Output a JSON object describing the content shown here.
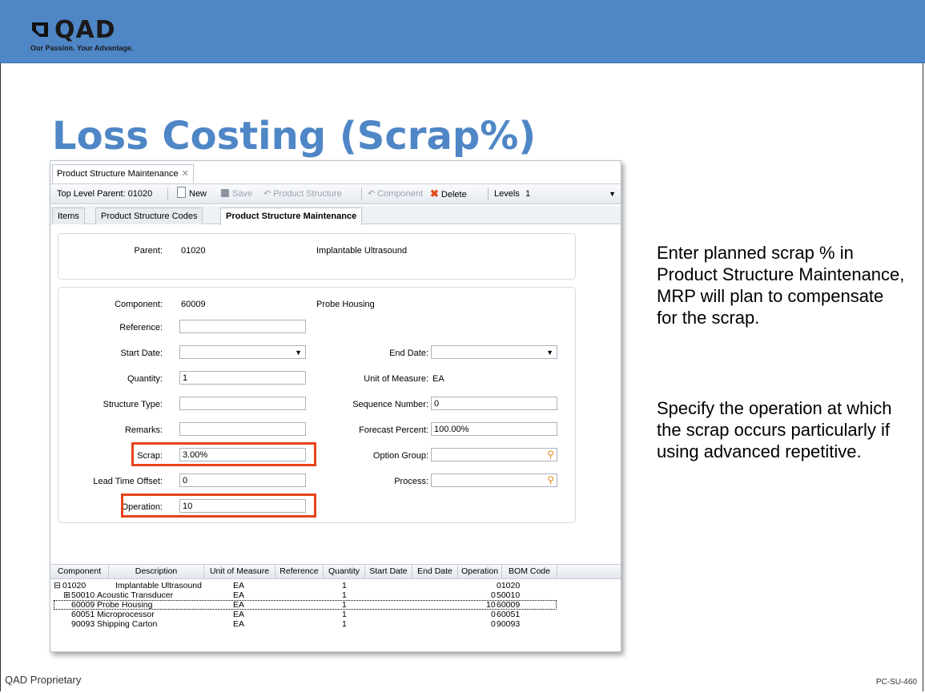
{
  "brand": {
    "name": "QAD",
    "tagline": "Our Passion. Your Advantage."
  },
  "slide": {
    "title": "Loss Costing (Scrap%)",
    "footer_left": "QAD Proprietary",
    "footer_right": "PC-SU-460"
  },
  "app": {
    "doc_tab": "Product Structure Maintenance",
    "toolbar": {
      "top_level_parent": "Top Level Parent: 01020",
      "new": "New",
      "save": "Save",
      "product_structure": "Product Structure",
      "component": "Component",
      "delete": "Delete",
      "levels_label": "Levels",
      "levels_value": "1"
    },
    "subtabs": [
      "Items",
      "Product Structure Codes",
      "Product Structure Maintenance"
    ],
    "parent_group": {
      "label": "Parent:",
      "code": "01020",
      "description": "Implantable Ultrasound"
    },
    "form": {
      "component_label": "Component:",
      "component_code": "60009",
      "component_desc": "Probe Housing",
      "reference_label": "Reference:",
      "reference_value": "",
      "start_date_label": "Start Date:",
      "start_date_value": "",
      "end_date_label": "End Date:",
      "end_date_value": "",
      "quantity_label": "Quantity:",
      "quantity_value": "1",
      "uom_label": "Unit of Measure:",
      "uom_value": "EA",
      "structure_type_label": "Structure Type:",
      "structure_type_value": "",
      "sequence_label": "Sequence Number:",
      "sequence_value": "0",
      "remarks_label": "Remarks:",
      "remarks_value": "",
      "forecast_label": "Forecast Percent:",
      "forecast_value": "100.00%",
      "scrap_label": "Scrap:",
      "scrap_value": "3.00%",
      "option_group_label": "Option Group:",
      "option_group_value": "",
      "lead_time_label": "Lead Time Offset:",
      "lead_time_value": "0",
      "process_label": "Process:",
      "process_value": "",
      "operation_label": "Operation:",
      "operation_value": "10"
    },
    "grid": {
      "columns": [
        "Component",
        "Description",
        "Unit of Measure",
        "Reference",
        "Quantity",
        "Start Date",
        "End Date",
        "Operation",
        "BOM Code"
      ],
      "rows": [
        {
          "expander": "⊟",
          "component": "01020",
          "description": "Implantable Ultrasound",
          "uom": "EA",
          "quantity": "1",
          "operation": "",
          "bom": "01020"
        },
        {
          "expander": "⊞",
          "component": "50010",
          "description": "Acoustic Transducer",
          "uom": "EA",
          "quantity": "1",
          "operation": "0",
          "bom": "50010"
        },
        {
          "expander": "",
          "component": "60009",
          "description": "Probe Housing",
          "uom": "EA",
          "quantity": "1",
          "operation": "10",
          "bom": "60009"
        },
        {
          "expander": "",
          "component": "60051",
          "description": "Microprocessor",
          "uom": "EA",
          "quantity": "1",
          "operation": "0",
          "bom": "60051"
        },
        {
          "expander": "",
          "component": "90093",
          "description": "Shipping Carton",
          "uom": "EA",
          "quantity": "1",
          "operation": "0",
          "bom": "90093"
        }
      ]
    }
  },
  "notes": {
    "p1": "Enter planned scrap % in Product Structure Maintenance, MRP will plan to compensate for the scrap.",
    "p2": "Specify the operation at which the scrap occurs particularly if using advanced repetitive."
  },
  "colors": {
    "banner": "#4f86c6",
    "title": "#4f86c6",
    "highlight": "#e8431c"
  }
}
